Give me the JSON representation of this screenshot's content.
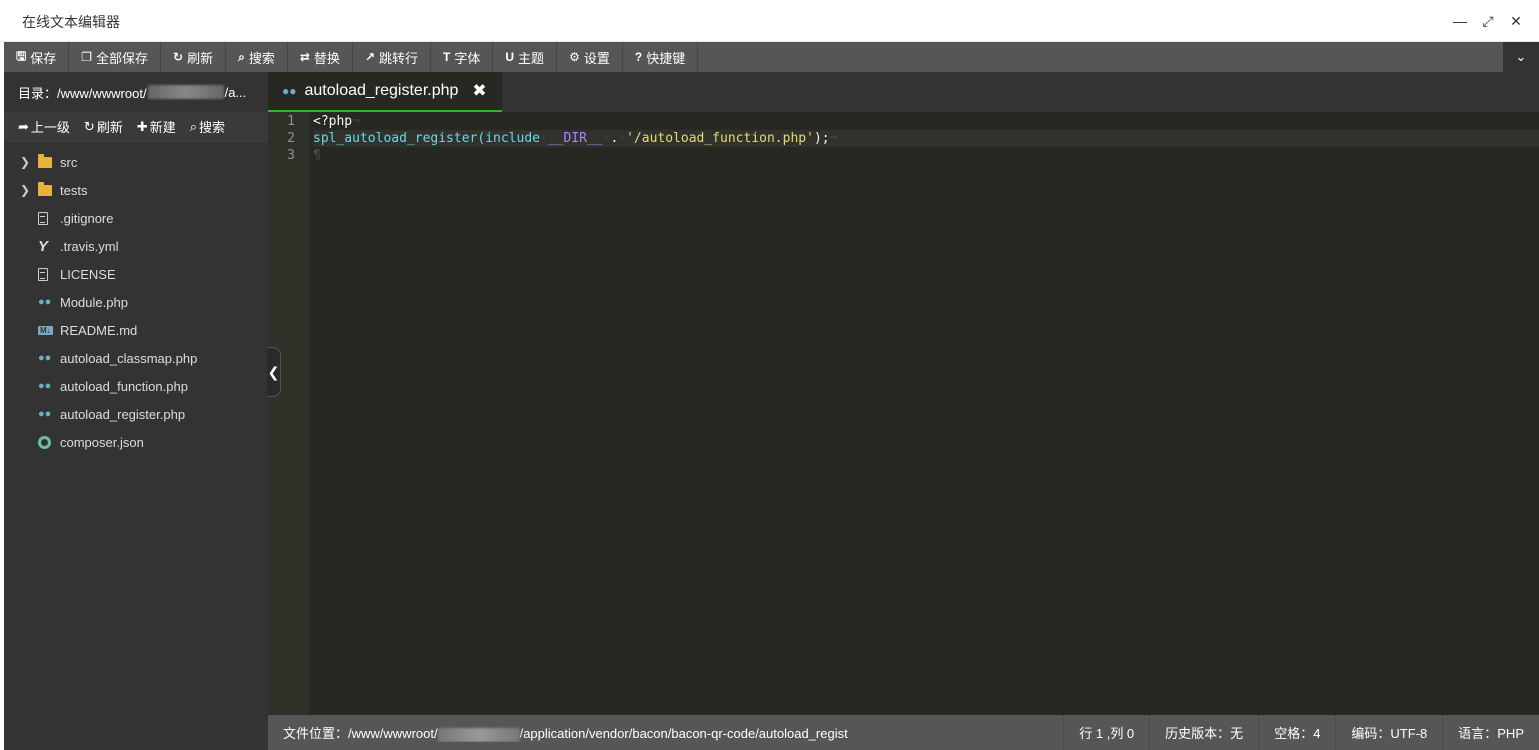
{
  "window": {
    "title": "在线文本编辑器",
    "controls": [
      "minimize-icon",
      "maximize-icon",
      "close-icon"
    ]
  },
  "toolbar": {
    "items": [
      {
        "icon": "save-icon",
        "label": "保存"
      },
      {
        "icon": "save-all-icon",
        "label": "全部保存"
      },
      {
        "icon": "refresh-icon",
        "label": "刷新"
      },
      {
        "icon": "search-icon",
        "label": "搜索"
      },
      {
        "icon": "replace-icon",
        "label": "替换"
      },
      {
        "icon": "pin-icon",
        "label": "跳转行"
      },
      {
        "icon": "font-icon",
        "label": "字体"
      },
      {
        "icon": "theme-icon",
        "label": "主题"
      },
      {
        "icon": "gear-icon",
        "label": "设置"
      },
      {
        "icon": "help-icon",
        "label": "快捷键"
      }
    ]
  },
  "sidebar": {
    "dir_prefix": "目录：/www/wwwroot/",
    "dir_suffix": "/a...",
    "actions": [
      {
        "icon": "up-icon",
        "label": "上一级"
      },
      {
        "icon": "refresh-icon",
        "label": "刷新"
      },
      {
        "icon": "plus-icon",
        "label": "新建"
      },
      {
        "icon": "search-icon",
        "label": "搜索"
      }
    ],
    "files": [
      {
        "name": "src",
        "type": "folder"
      },
      {
        "name": "tests",
        "type": "folder"
      },
      {
        "name": ".gitignore",
        "type": "doc"
      },
      {
        "name": ".travis.yml",
        "type": "yml"
      },
      {
        "name": "LICENSE",
        "type": "doc"
      },
      {
        "name": "Module.php",
        "type": "php"
      },
      {
        "name": "README.md",
        "type": "md"
      },
      {
        "name": "autoload_classmap.php",
        "type": "php"
      },
      {
        "name": "autoload_function.php",
        "type": "php"
      },
      {
        "name": "autoload_register.php",
        "type": "php"
      },
      {
        "name": "composer.json",
        "type": "json"
      }
    ]
  },
  "tab": {
    "label": "autoload_register.php"
  },
  "editor": {
    "line_numbers": [
      "1",
      "2",
      "3"
    ],
    "line1": "<?php",
    "line2": {
      "fn": "spl_autoload_register(",
      "kw": "include",
      "const": "__DIR__",
      "dot": ".",
      "str": "'/autoload_function.php'",
      "end": ");"
    }
  },
  "status": {
    "path_label": "文件位置：",
    "path_prefix": "/www/wwwroot/",
    "path_suffix": "/application/vendor/bacon/bacon-qr-code/autoload_regist",
    "cursor": "行 1 ,列 0",
    "history": "历史版本：无",
    "indent": "空格：4",
    "encoding": "编码：UTF-8",
    "language": "语言：PHP"
  }
}
